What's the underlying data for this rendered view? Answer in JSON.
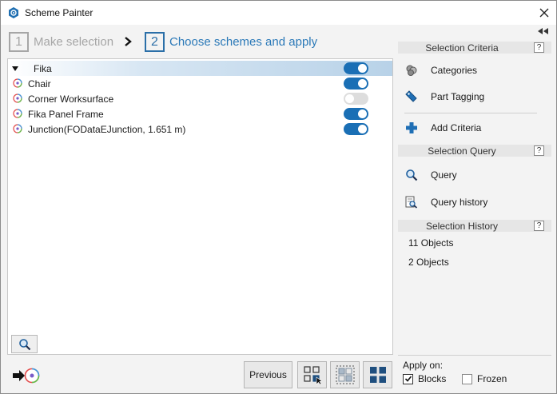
{
  "window": {
    "title": "Scheme Painter"
  },
  "steps": [
    {
      "number": "1",
      "label": "Make selection"
    },
    {
      "number": "2",
      "label": "Choose schemes and apply"
    }
  ],
  "list": {
    "group": {
      "label": "Fika",
      "enabled": true
    },
    "items": [
      {
        "label": "Chair",
        "enabled": true
      },
      {
        "label": "Corner Worksurface",
        "enabled": false
      },
      {
        "label": "Fika Panel Frame",
        "enabled": true
      },
      {
        "label": "Junction(FODataEJunction, 1.651 m)",
        "enabled": true
      }
    ]
  },
  "sections": {
    "criteria": {
      "title": "Selection Criteria",
      "help": "?",
      "items": {
        "categories": "Categories",
        "part_tagging": "Part Tagging",
        "add_criteria": "Add Criteria"
      }
    },
    "query": {
      "title": "Selection Query",
      "help": "?",
      "items": {
        "query": "Query",
        "query_history": "Query history"
      }
    },
    "history": {
      "title": "Selection History",
      "help": "?",
      "items": [
        "11 Objects",
        "2 Objects"
      ]
    }
  },
  "footer": {
    "previous_label": "Previous",
    "apply_on_label": "Apply on:",
    "blocks": {
      "label": "Blocks",
      "checked": true
    },
    "frozen": {
      "label": "Frozen",
      "checked": false
    }
  },
  "colors": {
    "accent": "#1a6fb5",
    "step_active": "#2b79b8",
    "step_inactive": "#a6a6a6"
  }
}
